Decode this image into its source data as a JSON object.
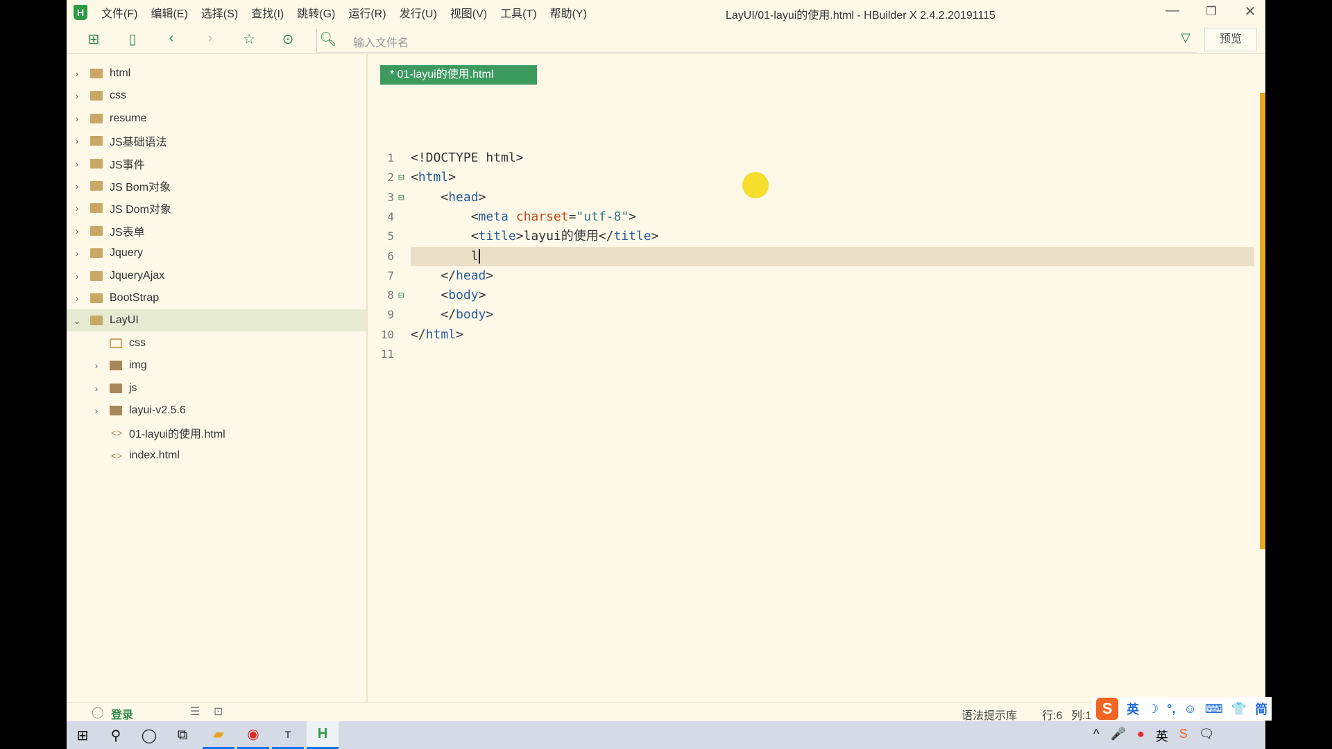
{
  "window": {
    "title": "LayUI/01-layui的使用.html - HBuilder X 2.4.2.20191115",
    "logo": "H"
  },
  "menu": [
    "文件(F)",
    "编辑(E)",
    "选择(S)",
    "查找(I)",
    "跳转(G)",
    "运行(R)",
    "发行(U)",
    "视图(V)",
    "工具(T)",
    "帮助(Y)"
  ],
  "toolbar": {
    "search_placeholder": "输入文件名",
    "preview_label": "预览",
    "icons": [
      "new-file-icon",
      "save-icon",
      "back-icon",
      "forward-icon",
      "star-icon",
      "run-icon",
      "file-search-icon",
      "filter-icon"
    ]
  },
  "sidebar": {
    "items": [
      {
        "label": "html",
        "level": 0,
        "type": "folder",
        "expanded": false
      },
      {
        "label": "css",
        "level": 0,
        "type": "folder",
        "expanded": false
      },
      {
        "label": "resume",
        "level": 0,
        "type": "folder",
        "expanded": false
      },
      {
        "label": "JS基础语法",
        "level": 0,
        "type": "folder",
        "expanded": false
      },
      {
        "label": "JS事件",
        "level": 0,
        "type": "folder",
        "expanded": false
      },
      {
        "label": "JS Bom对象",
        "level": 0,
        "type": "folder",
        "expanded": false
      },
      {
        "label": "JS Dom对象",
        "level": 0,
        "type": "folder",
        "expanded": false
      },
      {
        "label": "JS表单",
        "level": 0,
        "type": "folder",
        "expanded": false
      },
      {
        "label": "Jquery",
        "level": 0,
        "type": "folder",
        "expanded": false
      },
      {
        "label": "JqueryAjax",
        "level": 0,
        "type": "folder",
        "expanded": false
      },
      {
        "label": "BootStrap",
        "level": 0,
        "type": "folder",
        "expanded": false
      },
      {
        "label": "LayUI",
        "level": 0,
        "type": "folder",
        "expanded": true,
        "selected": true
      },
      {
        "label": "css",
        "level": 1,
        "type": "folder-empty"
      },
      {
        "label": "img",
        "level": 1,
        "type": "folder",
        "expanded": false
      },
      {
        "label": "js",
        "level": 1,
        "type": "folder",
        "expanded": false
      },
      {
        "label": "layui-v2.5.6",
        "level": 1,
        "type": "folder",
        "expanded": false
      },
      {
        "label": "01-layui的使用.html",
        "level": 1,
        "type": "file"
      },
      {
        "label": "index.html",
        "level": 1,
        "type": "file"
      }
    ]
  },
  "editor": {
    "tab": "* 01-layui的使用.html",
    "current_line": 6,
    "lines": [
      {
        "n": "1",
        "fold": "",
        "indent": "",
        "parts": [
          [
            "",
            "<!DOCTYPE html>"
          ]
        ]
      },
      {
        "n": "2",
        "fold": "⊟",
        "indent": "",
        "parts": [
          [
            "",
            "<"
          ],
          [
            "t",
            "html"
          ],
          [
            "",
            ">"
          ]
        ]
      },
      {
        "n": "3",
        "fold": "⊟",
        "indent": "    ",
        "parts": [
          [
            "",
            "<"
          ],
          [
            "t",
            "head"
          ],
          [
            "",
            ">"
          ]
        ]
      },
      {
        "n": "4",
        "fold": "",
        "indent": "        ",
        "parts": [
          [
            "",
            "<"
          ],
          [
            "t",
            "meta "
          ],
          [
            "a",
            "charset"
          ],
          [
            "",
            "="
          ],
          [
            "s",
            "\"utf-8\""
          ],
          [
            "",
            ">"
          ]
        ]
      },
      {
        "n": "5",
        "fold": "",
        "indent": "        ",
        "parts": [
          [
            "",
            "<"
          ],
          [
            "t",
            "title"
          ],
          [
            "",
            ">layui的使用</"
          ],
          [
            "t",
            "title"
          ],
          [
            "",
            ">"
          ]
        ]
      },
      {
        "n": "6",
        "fold": "",
        "indent": "        ",
        "parts": [
          [
            "",
            "l"
          ]
        ]
      },
      {
        "n": "7",
        "fold": "",
        "indent": "    ",
        "parts": [
          [
            "",
            "</"
          ],
          [
            "t",
            "head"
          ],
          [
            "",
            ">"
          ]
        ]
      },
      {
        "n": "8",
        "fold": "⊟",
        "indent": "    ",
        "parts": [
          [
            "",
            "<"
          ],
          [
            "t",
            "body"
          ],
          [
            "",
            ">"
          ]
        ]
      },
      {
        "n": "9",
        "fold": "",
        "indent": "    ",
        "parts": [
          [
            "",
            "</"
          ],
          [
            "t",
            "body"
          ],
          [
            "",
            ">"
          ]
        ]
      },
      {
        "n": "10",
        "fold": "",
        "indent": "",
        "parts": [
          [
            "",
            "</"
          ],
          [
            "t",
            "html"
          ],
          [
            "",
            ">"
          ]
        ]
      },
      {
        "n": "11",
        "fold": "",
        "indent": "",
        "parts": []
      }
    ]
  },
  "statusbar": {
    "login": "登录",
    "syntax_lib": "语法提示库",
    "row": "行:6",
    "col": "列:1"
  },
  "ime": {
    "brand": "S",
    "items": [
      "英",
      "☽",
      "°,",
      "☺",
      "⌨",
      "👕",
      "简"
    ]
  },
  "taskbar": {
    "tray": [
      "^",
      "🎤",
      "●",
      "英",
      "S",
      "🗨"
    ]
  },
  "colors": {
    "accent": "#2d9a46",
    "tab": "#3c9a5f",
    "scrollbar": "#e8a823",
    "background": "#fdf8e8"
  }
}
